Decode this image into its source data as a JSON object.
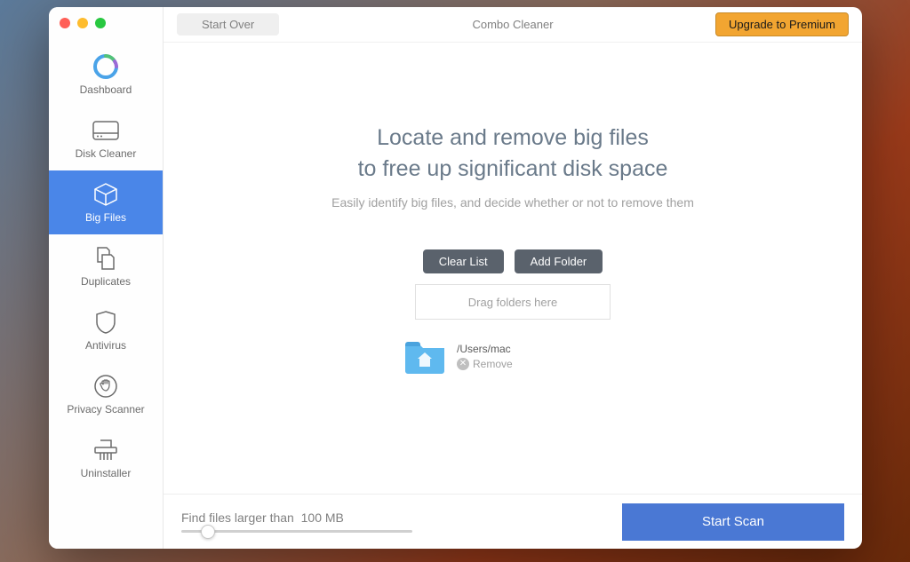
{
  "app_title": "Combo Cleaner",
  "topbar": {
    "start_over": "Start Over",
    "upgrade": "Upgrade to Premium"
  },
  "sidebar": {
    "items": [
      {
        "label": "Dashboard"
      },
      {
        "label": "Disk Cleaner"
      },
      {
        "label": "Big Files"
      },
      {
        "label": "Duplicates"
      },
      {
        "label": "Antivirus"
      },
      {
        "label": "Privacy Scanner"
      },
      {
        "label": "Uninstaller"
      }
    ],
    "active_index": 2
  },
  "content": {
    "headline_line1": "Locate and remove big files",
    "headline_line2": "to free up significant disk space",
    "subhead": "Easily identify big files, and decide whether or not to remove them",
    "clear_list": "Clear List",
    "add_folder": "Add Folder",
    "dropzone": "Drag folders here",
    "folder": {
      "path": "/Users/mac",
      "remove_label": "Remove"
    }
  },
  "bottombar": {
    "threshold_prefix": "Find files larger than",
    "threshold_value": "100 MB",
    "start_scan": "Start Scan"
  },
  "colors": {
    "accent": "#4a86e8",
    "upgrade": "#f2a531",
    "scan": "#4a78d4"
  }
}
